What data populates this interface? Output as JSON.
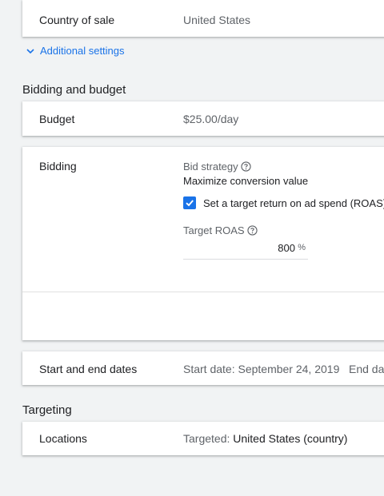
{
  "country": {
    "label": "Country of sale",
    "value": "United States"
  },
  "additional_settings": {
    "label": "Additional settings"
  },
  "bidding_section": {
    "title": "Bidding and budget"
  },
  "budget": {
    "label": "Budget",
    "value": "$25.00/day"
  },
  "bidding": {
    "label": "Bidding",
    "strategy_label": "Bid strategy",
    "strategy_value": "Maximize conversion value",
    "checkbox_label": "Set a target return on ad spend (ROAS)",
    "checkbox_checked": true,
    "roas_label": "Target ROAS",
    "roas_value": "800",
    "roas_unit": "%"
  },
  "dates": {
    "label": "Start and end dates",
    "start": "Start date: September 24, 2019",
    "end": "End dat"
  },
  "targeting_section": {
    "title": "Targeting"
  },
  "locations": {
    "label": "Locations",
    "prefix": "Targeted:",
    "value": "United States (country)"
  },
  "colors": {
    "accent": "#1a73e8",
    "background": "#f1f3f4",
    "card": "#ffffff",
    "muted": "#5f6368"
  }
}
